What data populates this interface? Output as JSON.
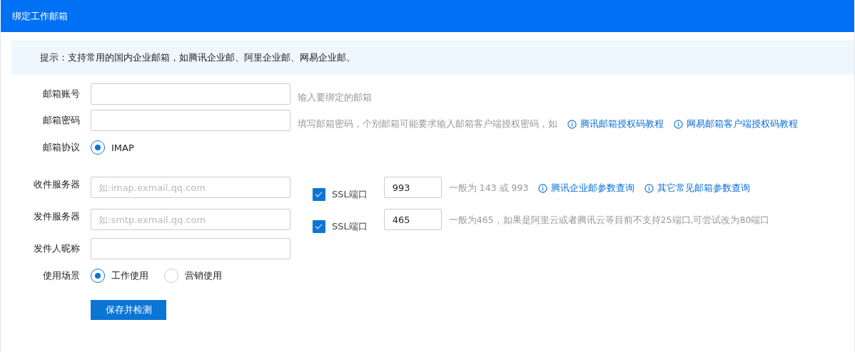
{
  "header": {
    "title": "绑定工作邮箱"
  },
  "tip": "提示：支持常用的国内企业邮箱，如腾讯企业邮、阿里企业邮、网易企业邮。",
  "fields": [
    {
      "kind": "text",
      "label": "邮箱账号",
      "hint": "输入要绑定的邮箱"
    },
    {
      "kind": "text",
      "label": "邮箱密码",
      "hint": "填写邮箱密码，个别邮箱可能要求输入邮箱客户端授权密码，如",
      "links": [
        "腾讯邮箱授权码教程",
        "网易邮箱客户端授权码教程"
      ]
    },
    {
      "kind": "radio",
      "label": "邮箱协议",
      "options": [
        {
          "label": "IMAP",
          "selected": true
        }
      ]
    },
    {
      "kind": "server",
      "label": "收件服务器",
      "placeholder": "如:imap.exmail.qq.com",
      "ssl_checked": true,
      "ssl_label": "SSL端口",
      "port": "993",
      "hint": "一般为 143 或 993",
      "links": [
        "腾讯企业邮参数查询",
        "其它常见邮箱参数查询"
      ]
    },
    {
      "kind": "server",
      "label": "发件服务器",
      "placeholder": "如:smtp.exmail.qq.com",
      "ssl_checked": true,
      "ssl_label": "SSL端口",
      "port": "465",
      "hint": "一般为465，如果是阿里云或者腾讯云等目前不支持25端口,可尝试改为80端口"
    },
    {
      "kind": "text",
      "label": "发件人昵称"
    },
    {
      "kind": "radio",
      "label": "使用场景",
      "options": [
        {
          "label": "工作使用",
          "selected": true
        },
        {
          "label": "营销使用",
          "selected": false
        }
      ]
    }
  ],
  "submit": "保存并检测"
}
